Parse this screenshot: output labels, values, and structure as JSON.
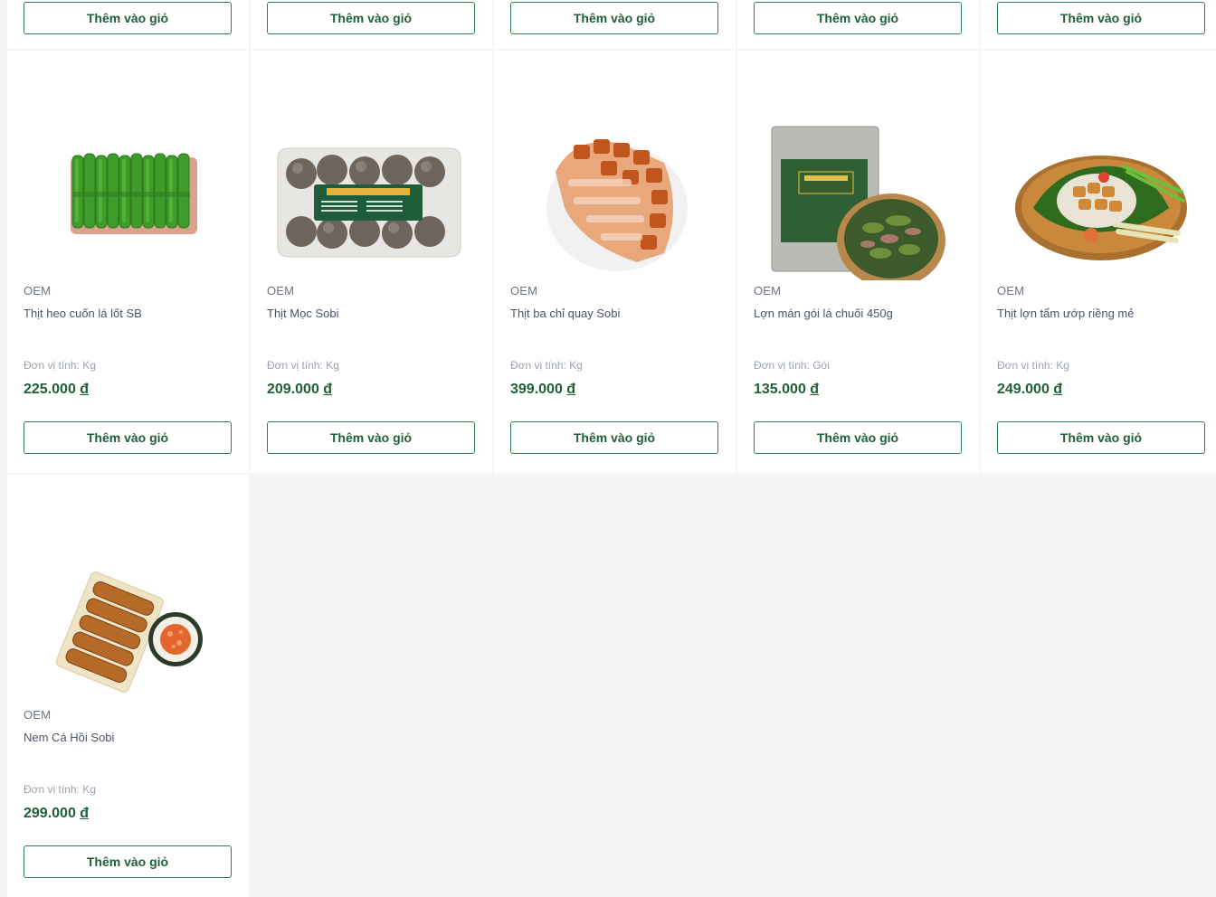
{
  "add_to_cart_label": "Thêm vào giỏ",
  "currency_symbol": "đ",
  "top_row_buttons": [
    "Thêm vào giỏ",
    "Thêm vào giỏ",
    "Thêm vào giỏ",
    "Thêm vào giỏ",
    "Thêm vào giỏ"
  ],
  "products": [
    {
      "brand": "OEM",
      "name": "Thịt heo cuốn lá lốt SB",
      "unit": "Đơn vị tính: Kg",
      "price": "225.000",
      "image": "leaf-rolls-image"
    },
    {
      "brand": "OEM",
      "name": "Thịt Mọc Sobi",
      "unit": "Đơn vị tính: Kg",
      "price": "209.000",
      "image": "meatball-pack-image"
    },
    {
      "brand": "OEM",
      "name": "Thịt ba chỉ quay Sobi",
      "unit": "Đơn vị tính: Kg",
      "price": "399.000",
      "image": "roast-pork-image"
    },
    {
      "brand": "OEM",
      "name": "Lợn mán gói lá chuối 450g",
      "unit": "Đơn vị tính: Gói",
      "price": "135.000",
      "image": "pork-pack-bowl-image"
    },
    {
      "brand": "OEM",
      "name": "Thịt lợn tẩm ướp riềng mẻ",
      "unit": "Đơn vị tính: Kg",
      "price": "249.000",
      "image": "galangal-pork-tray-image"
    },
    {
      "brand": "OEM",
      "name": "Nem Cá Hồi Sobi",
      "unit": "Đơn vị tính: Kg",
      "price": "299.000",
      "image": "spring-rolls-sauce-image"
    }
  ],
  "colors": {
    "accent": "#1f5f3a",
    "button_border": "#2f7d4f",
    "background": "#f5f5f5",
    "card": "#ffffff"
  }
}
